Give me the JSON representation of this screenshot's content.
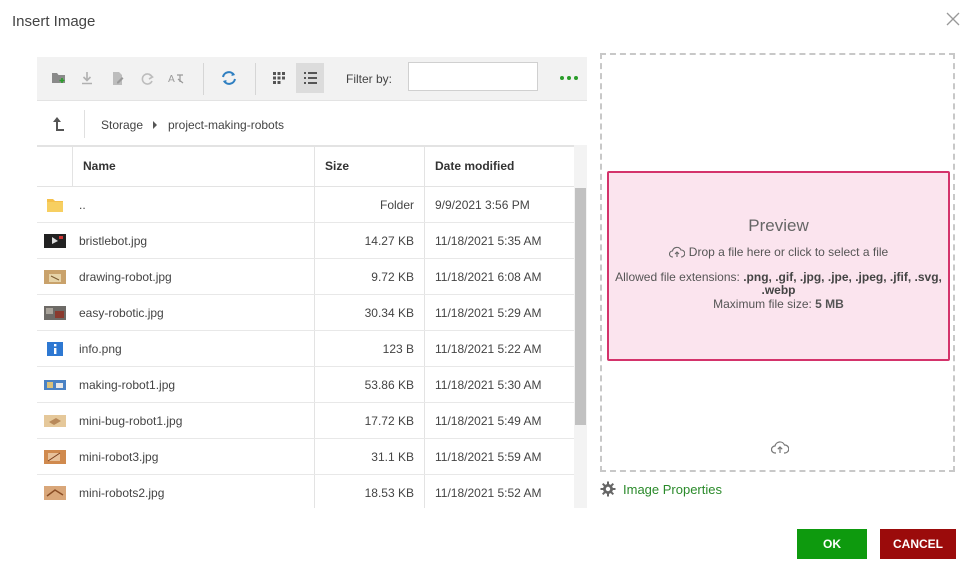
{
  "dialog": {
    "title": "Insert Image"
  },
  "toolbar": {
    "filter_label": "Filter by:",
    "filter_value": "",
    "accent_color": "#2a9d2a"
  },
  "breadcrumb": {
    "root": "Storage",
    "folder": "project-making-robots"
  },
  "columns": {
    "name": "Name",
    "size": "Size",
    "date": "Date modified"
  },
  "files": [
    {
      "name": "..",
      "size": "Folder",
      "date": "9/9/2021 3:56 PM",
      "icon": "folder-icon"
    },
    {
      "name": "bristlebot.jpg",
      "size": "14.27 KB",
      "date": "11/18/2021 5:35 AM",
      "icon": "image-thumbnail-icon"
    },
    {
      "name": "drawing-robot.jpg",
      "size": "9.72 KB",
      "date": "11/18/2021 6:08 AM",
      "icon": "image-thumbnail-icon"
    },
    {
      "name": "easy-robotic.jpg",
      "size": "30.34 KB",
      "date": "11/18/2021 5:29 AM",
      "icon": "image-thumbnail-icon"
    },
    {
      "name": "info.png",
      "size": "123 B",
      "date": "11/18/2021 5:22 AM",
      "icon": "info-icon"
    },
    {
      "name": "making-robot1.jpg",
      "size": "53.86 KB",
      "date": "11/18/2021 5:30 AM",
      "icon": "image-thumbnail-icon"
    },
    {
      "name": "mini-bug-robot1.jpg",
      "size": "17.72 KB",
      "date": "11/18/2021 5:49 AM",
      "icon": "image-thumbnail-icon"
    },
    {
      "name": "mini-robot3.jpg",
      "size": "31.1 KB",
      "date": "11/18/2021 5:59 AM",
      "icon": "image-thumbnail-icon"
    },
    {
      "name": "mini-robots2.jpg",
      "size": "18.53 KB",
      "date": "11/18/2021 5:52 AM",
      "icon": "image-thumbnail-icon"
    }
  ],
  "preview": {
    "title": "Preview",
    "hint": "Drop a file here or click to select a file",
    "extensions_label": "Allowed file extensions:",
    "extensions": ".png, .gif, .jpg, .jpe, .jpeg, .jfif, .svg, .webp",
    "max_size_label": "Maximum file size:",
    "max_size": "5 MB",
    "border_color": "#d4336b",
    "fill_color": "#fbe4ee"
  },
  "image_properties": {
    "label": "Image Properties",
    "color": "#2a8a2a"
  },
  "buttons": {
    "ok": "OK",
    "cancel": "CANCEL",
    "ok_color": "#0e9a0e",
    "cancel_color": "#9b0b0b"
  }
}
